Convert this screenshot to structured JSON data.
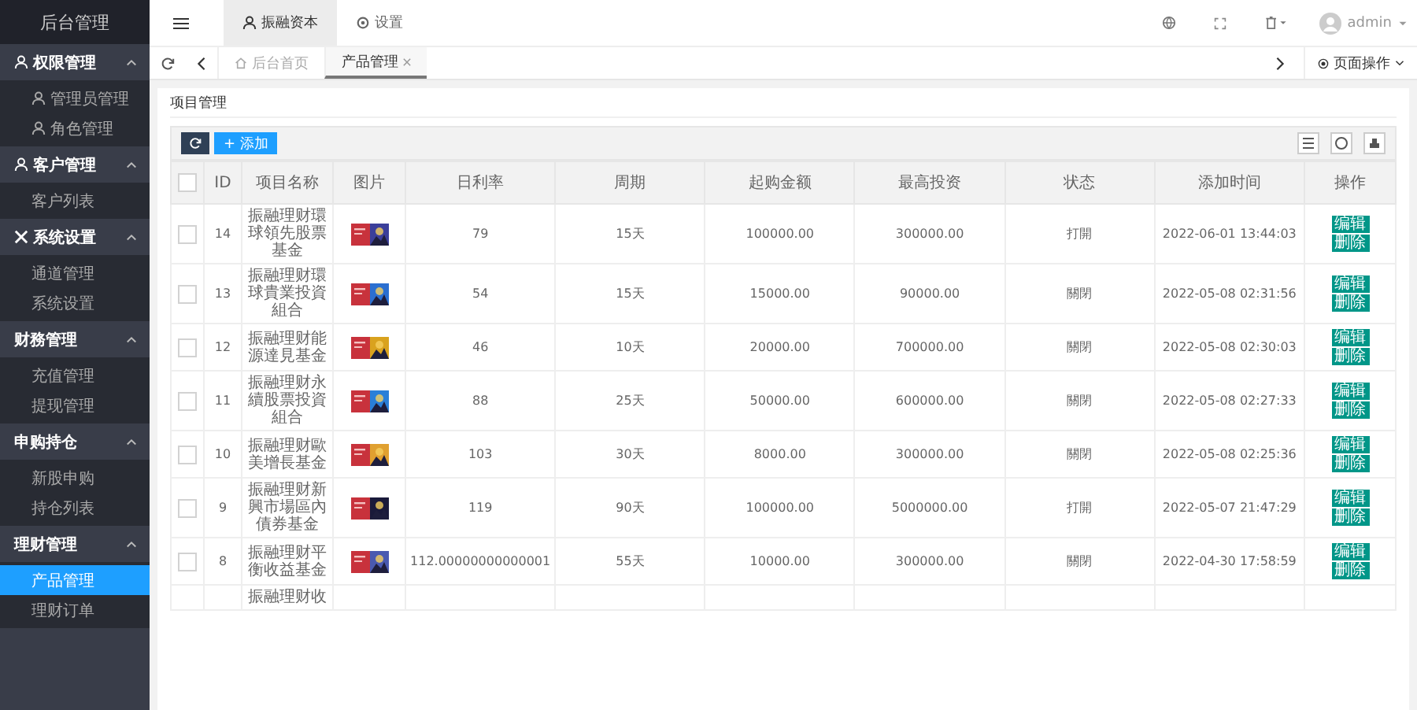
{
  "sidebar": {
    "title": "后台管理",
    "groups": [
      {
        "label": "权限管理",
        "expanded": true,
        "items": [
          {
            "label": "管理员管理",
            "selected": false
          },
          {
            "label": "角色管理",
            "selected": false
          }
        ]
      },
      {
        "label": "客户管理",
        "expanded": true,
        "items": [
          {
            "label": "客户列表",
            "selected": false
          }
        ]
      },
      {
        "label": "系统设置",
        "expanded": true,
        "items": [
          {
            "label": "通道管理",
            "selected": false
          },
          {
            "label": "系统设置",
            "selected": false
          }
        ]
      },
      {
        "label": "财務管理",
        "expanded": true,
        "items": [
          {
            "label": "充值管理",
            "selected": false
          },
          {
            "label": "提现管理",
            "selected": false
          }
        ]
      },
      {
        "label": "申购持仓",
        "expanded": true,
        "items": [
          {
            "label": "新股申购",
            "selected": false
          },
          {
            "label": "持仓列表",
            "selected": false
          }
        ]
      },
      {
        "label": "理财管理",
        "expanded": true,
        "items": [
          {
            "label": "产品管理",
            "selected": true
          },
          {
            "label": "理财订单",
            "selected": false
          }
        ]
      }
    ]
  },
  "top_tabs": [
    {
      "label": "振融资本",
      "selected": true
    },
    {
      "label": "设置",
      "selected": false
    }
  ],
  "user": {
    "name": "admin"
  },
  "page_tabs": [
    {
      "label": "后台首页",
      "selected": false,
      "closable": false
    },
    {
      "label": "产品管理",
      "selected": true,
      "closable": true
    }
  ],
  "page_actions": "页面操作",
  "card": {
    "title": "项目管理",
    "add_button": "+ 添加"
  },
  "table": {
    "header_checked": false,
    "columns": [
      "ID",
      "项目名称",
      "图片",
      "日利率",
      "周期",
      "起购金额",
      "最高投资",
      "状态",
      "添加时间",
      "操作"
    ],
    "rows": [
      {
        "checked": false,
        "id": "14",
        "name": "振融理财環球領先股票基金",
        "rate": "79",
        "period": "15天",
        "min": "100000.00",
        "max": "300000.00",
        "status": "打開",
        "time": "2022-06-01 13:44:03",
        "actions": [
          "编辑",
          "删除"
        ]
      },
      {
        "checked": false,
        "id": "13",
        "name": "振融理财環球貴業投資組合",
        "rate": "54",
        "period": "15天",
        "min": "15000.00",
        "max": "90000.00",
        "status": "關閉",
        "time": "2022-05-08 02:31:56",
        "actions": [
          "编辑",
          "删除"
        ]
      },
      {
        "checked": false,
        "id": "12",
        "name": "振融理财能源達見基金",
        "rate": "46",
        "period": "10天",
        "min": "20000.00",
        "max": "700000.00",
        "status": "關閉",
        "time": "2022-05-08 02:30:03",
        "actions": [
          "编辑",
          "删除"
        ]
      },
      {
        "checked": false,
        "id": "11",
        "name": "振融理财永續股票投資組合",
        "rate": "88",
        "period": "25天",
        "min": "50000.00",
        "max": "600000.00",
        "status": "關閉",
        "time": "2022-05-08 02:27:33",
        "actions": [
          "编辑",
          "删除"
        ]
      },
      {
        "checked": false,
        "id": "10",
        "name": "振融理财歐美增長基金",
        "rate": "103",
        "period": "30天",
        "min": "8000.00",
        "max": "300000.00",
        "status": "關閉",
        "time": "2022-05-08 02:25:36",
        "actions": [
          "编辑",
          "删除"
        ]
      },
      {
        "checked": false,
        "id": "9",
        "name": "振融理财新興市場區內債券基金",
        "rate": "119",
        "period": "90天",
        "min": "100000.00",
        "max": "5000000.00",
        "status": "打開",
        "time": "2022-05-07 21:47:29",
        "actions": [
          "编辑",
          "删除"
        ]
      },
      {
        "checked": false,
        "id": "8",
        "name": "振融理财平衡收益基金",
        "rate": "112.00000000000001",
        "period": "55天",
        "min": "10000.00",
        "max": "300000.00",
        "status": "關閉",
        "time": "2022-04-30 17:58:59",
        "actions": [
          "编辑",
          "删除"
        ]
      },
      {
        "name": "振融理财收"
      }
    ]
  }
}
